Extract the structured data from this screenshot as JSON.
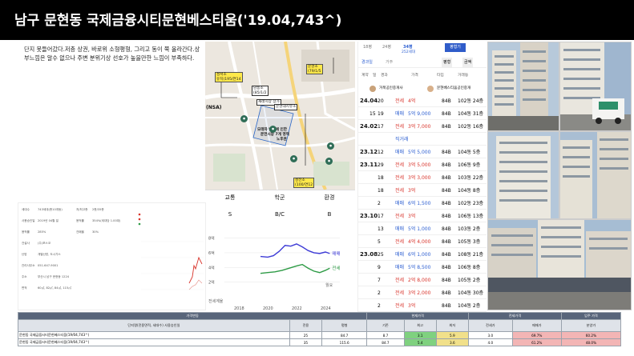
{
  "title": "남구 문현동 국제금융시티문현베스티움('19.04,743^)",
  "description": "단지 못들어갔다.저층 상권, 바로위 소형평형, 그리고 동이 쭉 올라간다.상부느낌은 알수 없으나 주변 분위기상 선호가 높을만한 느낌이 부족하다.",
  "map": {
    "labels": [
      "성서초",
      "남동초",
      "문현초",
      "재래시장 상가",
      "문현대지유초",
      "모래차 변동에 인한",
      "문전시장 7개 영역",
      "성전초",
      "노후관",
      "(NSA)"
    ],
    "labels_small": [
      "유치(195/연14",
      "(85/1/2",
      "(79/1/5",
      "(100/연12"
    ]
  },
  "grades": {
    "headers": [
      "교통",
      "학군",
      "환경"
    ],
    "values": [
      "S",
      "B/C",
      "B"
    ]
  },
  "listing": {
    "top": {
      "a": "18평",
      "b": "24평",
      "c": "34평",
      "d": "252세대",
      "button": "평형기"
    },
    "filters": [
      "경과일",
      "거주",
      "평형",
      "금액"
    ],
    "columns": [
      "계약",
      "일",
      "경과",
      "가격",
      "타입",
      "거래동"
    ],
    "agents": [
      "거북공인중개사",
      "문현베스티움공인중개"
    ],
    "rows": [
      {
        "date": "24.04",
        "day": "20",
        "kind": "전세",
        "price": "4억",
        "type": "84B",
        "dong": "102동 24층"
      },
      {
        "date": "",
        "day": "19",
        "gap": "15",
        "kind": "매매",
        "price": "5억 9,000",
        "type": "84B",
        "dong": "104동 31층"
      },
      {
        "date": "24.02",
        "day": "17",
        "kind": "전세",
        "price": "3억 7,000",
        "type": "84B",
        "dong": "102동 16층"
      },
      {
        "date": "",
        "day": "",
        "kind": "직거래",
        "price": "",
        "type": "",
        "dong": ""
      },
      {
        "date": "23.12",
        "day": "12",
        "kind": "매매",
        "price": "5억 5,000",
        "type": "84B",
        "dong": "104동 5층"
      },
      {
        "date": "23.11",
        "day": "29",
        "kind": "전세",
        "price": "3억 5,000",
        "type": "84B",
        "dong": "106동 9층"
      },
      {
        "date": "",
        "day": "18",
        "kind": "전세",
        "price": "3억 3,000",
        "type": "84B",
        "dong": "103동 22층"
      },
      {
        "date": "",
        "day": "18",
        "kind": "전세",
        "price": "3억",
        "type": "84B",
        "dong": "104동 8층"
      },
      {
        "date": "",
        "day": "2",
        "kind": "매매",
        "price": "6억 1,500",
        "type": "84B",
        "dong": "102동 23층"
      },
      {
        "date": "23.10",
        "day": "17",
        "kind": "전세",
        "price": "3억",
        "type": "84B",
        "dong": "106동 13층"
      },
      {
        "date": "",
        "day": "13",
        "kind": "매매",
        "price": "5억 1,000",
        "type": "84B",
        "dong": "103동 2층"
      },
      {
        "date": "",
        "day": "5",
        "kind": "전세",
        "price": "4억 4,000",
        "type": "84B",
        "dong": "105동 3층"
      },
      {
        "date": "23.08",
        "day": "25",
        "kind": "매매",
        "price": "6억 1,000",
        "type": "84B",
        "dong": "108동 21층"
      },
      {
        "date": "",
        "day": "9",
        "kind": "매매",
        "price": "5억 8,500",
        "type": "84B",
        "dong": "106동 8층"
      },
      {
        "date": "",
        "day": "7",
        "kind": "전세",
        "price": "2억 8,000",
        "type": "84B",
        "dong": "105동 2층"
      },
      {
        "date": "",
        "day": "2",
        "kind": "전세",
        "price": "3억 2,000",
        "type": "84B",
        "dong": "104동 30층"
      },
      {
        "date": "",
        "day": "2",
        "kind": "전세",
        "price": "3억",
        "type": "84B",
        "dong": "104동 2층"
      }
    ]
  },
  "info": {
    "rows": [
      [
        "세대수",
        "743세대(총10개동)",
        "저/최고층",
        "2층/35층"
      ],
      [
        "사용승인일",
        "2019년 04월 일",
        "용적률",
        "354%(세대당 1.00대)"
      ],
      [
        "용적률",
        "285%",
        "건폐율",
        "30%"
      ],
      [
        "건설사",
        "(주)포스코"
      ],
      [
        "난방",
        "개별난방, 도시가스"
      ],
      [
        "관리사무소",
        "051-647-9001"
      ],
      [
        "주소",
        "부산시 남구 문현동 1224"
      ],
      [
        "면적",
        "60㎡, 82㎡, 84㎡, 115㎡"
      ]
    ]
  },
  "chart_data": {
    "type": "line",
    "x_ticks": [
      "2018",
      "2020",
      "2022",
      "2024"
    ],
    "y_ticks": [
      "8억",
      "6억",
      "4억",
      "2억"
    ],
    "labels": [
      "매매",
      "전세",
      "월요",
      "전세계율"
    ],
    "series": [
      {
        "name": "매매",
        "color": "#3d3bd6",
        "points": [
          [
            2019.5,
            5.5
          ],
          [
            2020.0,
            5.4
          ],
          [
            2020.4,
            5.6
          ],
          [
            2020.8,
            6.2
          ],
          [
            2021.2,
            7.0
          ],
          [
            2021.6,
            6.9
          ],
          [
            2022.0,
            7.2
          ],
          [
            2022.4,
            6.8
          ],
          [
            2022.8,
            6.3
          ],
          [
            2023.2,
            6.0
          ],
          [
            2023.6,
            5.9
          ],
          [
            2024.0,
            6.1
          ],
          [
            2024.3,
            5.9
          ]
        ]
      },
      {
        "name": "전세",
        "color": "#2e9b46",
        "points": [
          [
            2019.5,
            3.2
          ],
          [
            2020.0,
            3.3
          ],
          [
            2020.5,
            3.4
          ],
          [
            2021.0,
            3.6
          ],
          [
            2021.5,
            3.9
          ],
          [
            2022.0,
            4.2
          ],
          [
            2022.4,
            4.4
          ],
          [
            2022.8,
            3.9
          ],
          [
            2023.2,
            3.5
          ],
          [
            2023.6,
            3.3
          ],
          [
            2024.0,
            3.6
          ],
          [
            2024.3,
            3.9
          ]
        ]
      }
    ]
  },
  "bottom_table": {
    "header_group": [
      "가격변동",
      "현재가격",
      "전세가격",
      "입주 가격",
      "통장 관련"
    ],
    "subheaders": [
      "단지명(전용면적, 세대수) 사용승인일",
      "전용",
      "평형",
      "기존",
      "최고",
      "최저",
      "전세가",
      "매매가",
      "분양가"
    ],
    "rows": [
      [
        "문현동 국제금융시티문현베스티움(19/04,743^)",
        "25",
        "84.7",
        "8.7",
        "3.1",
        "5.9",
        "3.0",
        "69.7%",
        "60.2%"
      ],
      [
        "문현동 국제금융시티문현베스티움(19/04,743^)",
        "35",
        "115.6",
        "84.7",
        "5.4",
        "3.6",
        "4.0",
        "61.2%",
        "48.0%"
      ]
    ]
  }
}
